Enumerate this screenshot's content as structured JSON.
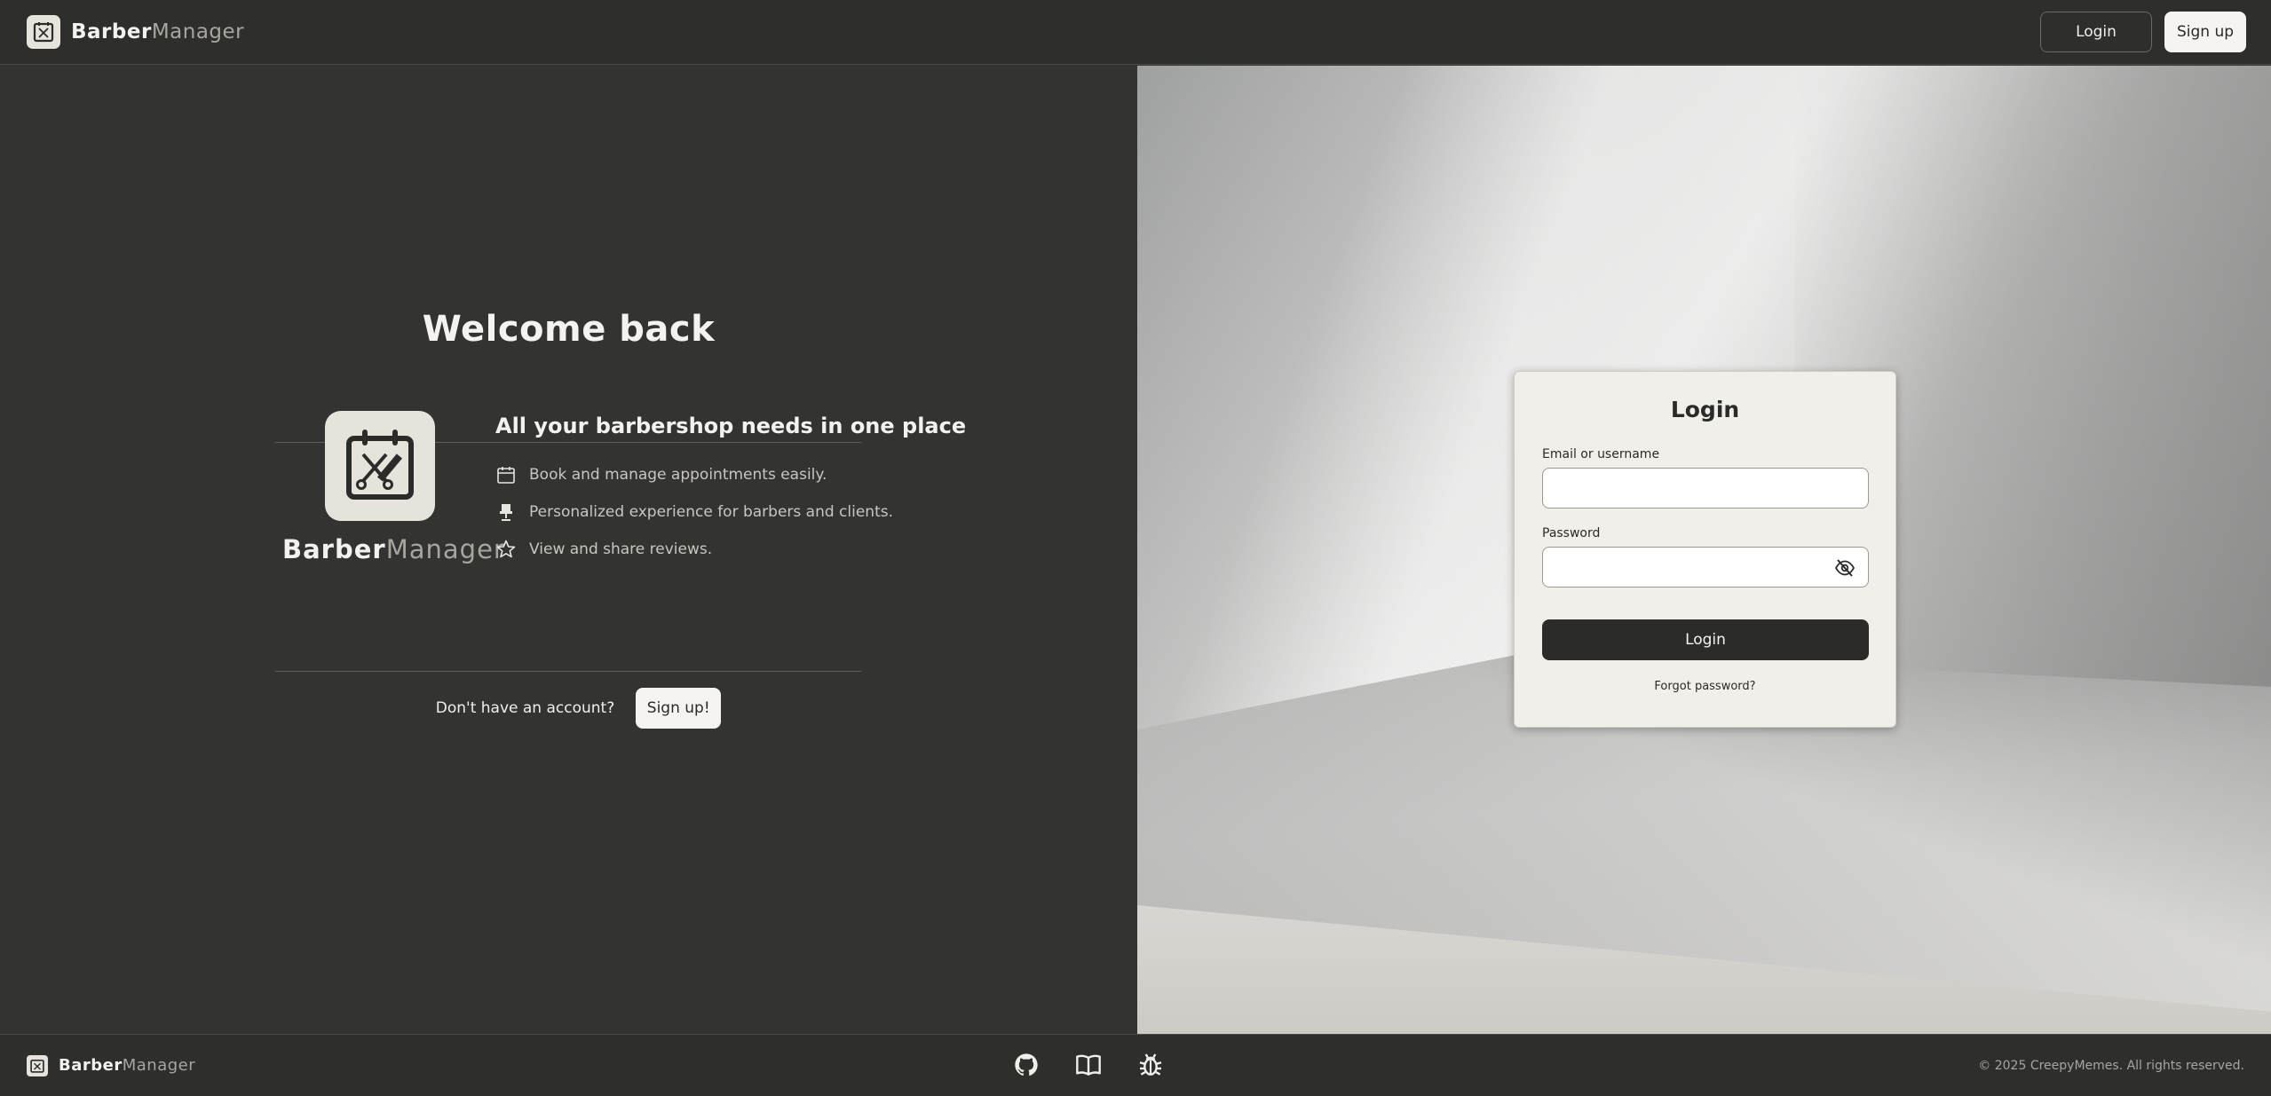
{
  "header": {
    "brand_strong": "Barber",
    "brand_light": "Manager",
    "login_label": "Login",
    "signup_label": "Sign up"
  },
  "left_panel": {
    "welcome_title": "Welcome back",
    "brand_strong": "Barber",
    "brand_light": "Manager",
    "tagline": "All your barbershop needs in one place",
    "features": [
      {
        "icon": "calendar-icon",
        "text": "Book and manage appointments easily."
      },
      {
        "icon": "barber-chair-icon",
        "text": "Personalized experience for barbers and clients."
      },
      {
        "icon": "star-icon",
        "text": "View and share reviews."
      }
    ],
    "signup_question": "Don't have an account?",
    "signup_button": "Sign up!"
  },
  "login_card": {
    "title": "Login",
    "email_label": "Email or username",
    "email_value": "",
    "password_label": "Password",
    "password_value": "",
    "submit_label": "Login",
    "forgot_label": "Forgot password?"
  },
  "footer": {
    "brand_strong": "Barber",
    "brand_light": "Manager",
    "icons": [
      "github-icon",
      "book-icon",
      "bug-icon"
    ],
    "copyright": "© 2025 CreepyMemes. All rights reserved."
  },
  "colors": {
    "background": "#333332",
    "header": "#2e2e2d",
    "card": "#f1efea",
    "accent_dark": "#2b2b2a",
    "muted_text": "#a8a59f"
  }
}
